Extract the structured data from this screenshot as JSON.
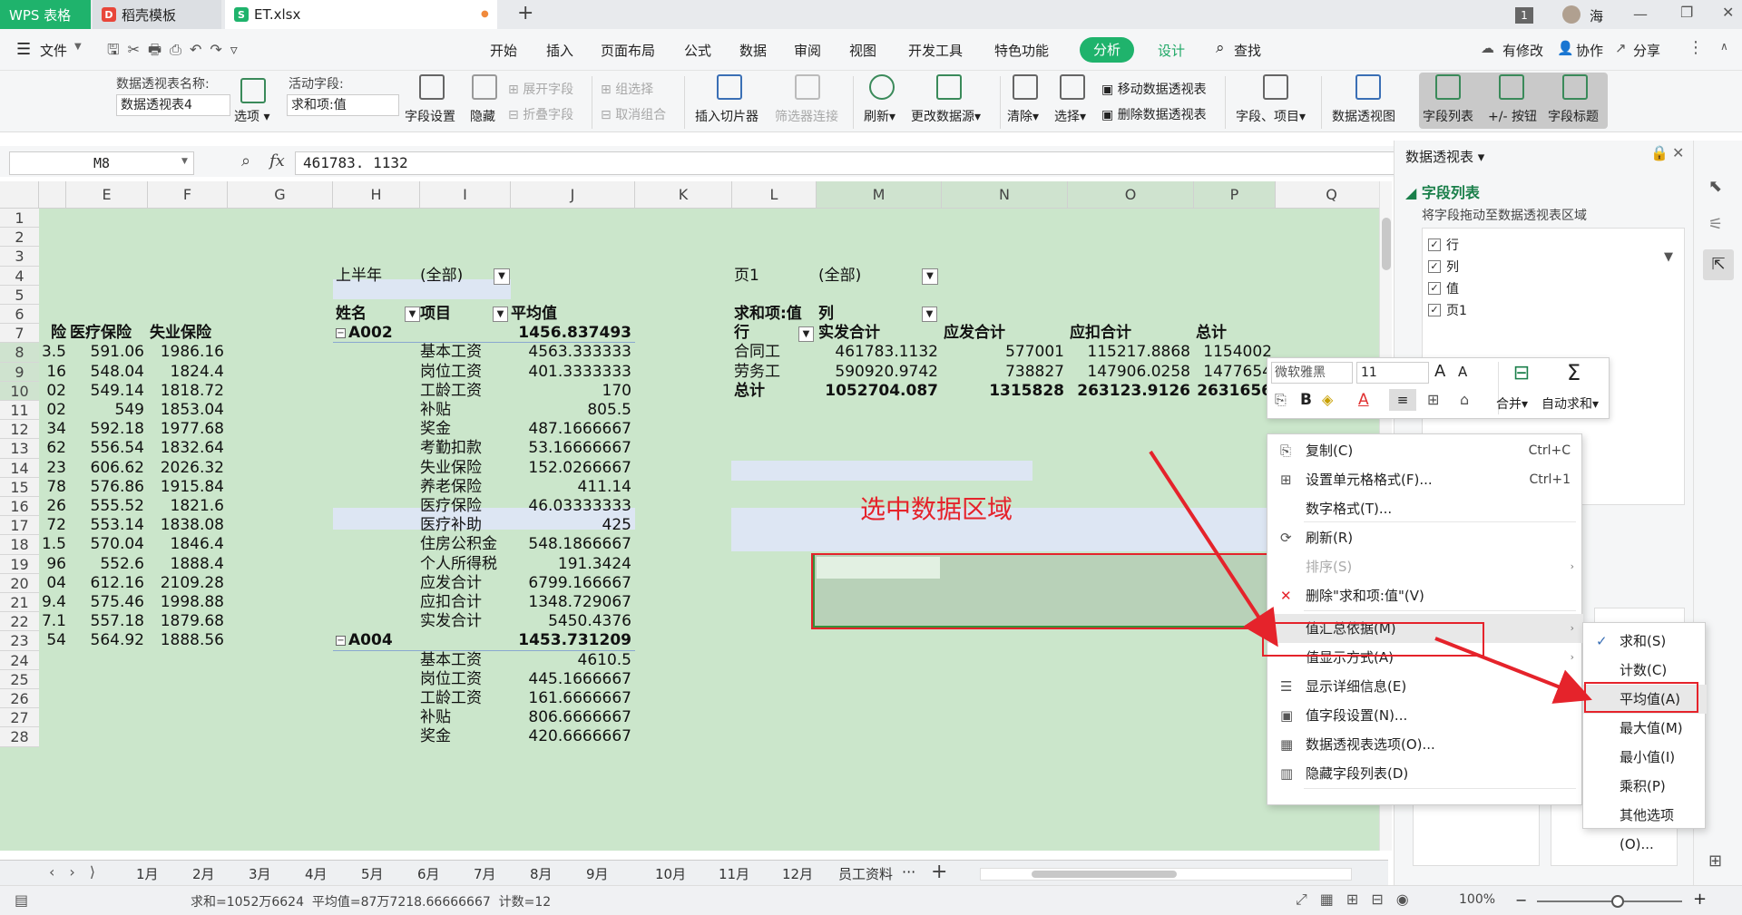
{
  "titlebar": {
    "wps_tab": "WPS 表格",
    "daoke_tab": "稻壳模板",
    "file_tab": "ET.xlsx",
    "new_tab": "+",
    "badge": "1",
    "user": "海"
  },
  "menubar": {
    "file": "文件",
    "items": [
      "开始",
      "插入",
      "页面布局",
      "公式",
      "数据",
      "审阅",
      "视图",
      "开发工具",
      "特色功能"
    ],
    "active": "分析",
    "design": "设计",
    "search": "查找",
    "right": [
      "有修改",
      "协作",
      "分享"
    ]
  },
  "ribbon": {
    "pt_name_label": "数据透视表名称:",
    "pt_name_value": "数据透视表4",
    "options": "选项",
    "active_field_label": "活动字段:",
    "active_field_value": "求和项:值",
    "field_settings": "字段设置",
    "hide": "隐藏",
    "expand_field": "展开字段",
    "collapse_field": "折叠字段",
    "group_sel": "组选择",
    "ungroup": "取消组合",
    "insert_slicer": "插入切片器",
    "filter_conn": "筛选器连接",
    "refresh": "刷新",
    "change_source": "更改数据源",
    "clear": "清除",
    "select": "选择",
    "move_pt": "移动数据透视表",
    "delete_pt": "删除数据透视表",
    "fields_items": "字段、项目",
    "pivot_chart": "数据透视图",
    "field_list": "字段列表",
    "pm_buttons": "+/- 按钮",
    "field_headers": "字段标题"
  },
  "formula": {
    "name_box": "M8",
    "fx": "fx",
    "value": "461783. 1132"
  },
  "columns": [
    "E",
    "F",
    "G",
    "H",
    "I",
    "J",
    "K",
    "L",
    "M",
    "N",
    "O",
    "P",
    "Q"
  ],
  "rows": [
    "1",
    "2",
    "3",
    "4",
    "5",
    "6",
    "7",
    "8",
    "9",
    "10",
    "11",
    "12",
    "13",
    "14",
    "15",
    "16",
    "17",
    "18",
    "19",
    "20",
    "21",
    "22",
    "23",
    "24",
    "25",
    "26",
    "27",
    "28"
  ],
  "left_table": {
    "headers": [
      "医疗保险",
      "失业保险"
    ],
    "d_partial": [
      "3.5",
      "16",
      "02",
      "02",
      "34",
      "62",
      "23",
      "78",
      "26",
      "72",
      "1.5",
      "96",
      "04",
      "9.4",
      "7.1",
      "54"
    ],
    "e_vals": [
      "591.06",
      "548.04",
      "549.14",
      "549",
      "592.18",
      "556.54",
      "606.62",
      "576.86",
      "555.52",
      "553.14",
      "570.04",
      "552.6",
      "612.16",
      "575.46",
      "557.18",
      "564.92"
    ],
    "f_vals": [
      "1986.16",
      "1824.4",
      "1818.72",
      "1853.04",
      "1977.68",
      "1832.64",
      "2026.32",
      "1915.84",
      "1821.6",
      "1838.08",
      "1846.4",
      "1888.4",
      "2109.28",
      "1998.88",
      "1879.68",
      "1888.56"
    ],
    "d_header_partial": "险"
  },
  "pivot1": {
    "filter_label": "上半年",
    "filter_value": "(全部)",
    "headers": [
      "姓名",
      "项目",
      "平均值"
    ],
    "group1": {
      "name": "A002",
      "total": "1456.837493"
    },
    "items1": [
      [
        "基本工资",
        "4563.333333"
      ],
      [
        "岗位工资",
        "401.3333333"
      ],
      [
        "工龄工资",
        "170"
      ],
      [
        "补贴",
        "805.5"
      ],
      [
        "奖金",
        "487.1666667"
      ],
      [
        "考勤扣款",
        "53.16666667"
      ],
      [
        "失业保险",
        "152.0266667"
      ],
      [
        "养老保险",
        "411.14"
      ],
      [
        "医疗保险",
        "46.03333333"
      ],
      [
        "医疗补助",
        "425"
      ],
      [
        "住房公积金",
        "548.1866667"
      ],
      [
        "个人所得税",
        "191.3424"
      ],
      [
        "应发合计",
        "6799.166667"
      ],
      [
        "应扣合计",
        "1348.729067"
      ],
      [
        "实发合计",
        "5450.4376"
      ]
    ],
    "group2": {
      "name": "A004",
      "total": "1453.731209"
    },
    "items2": [
      [
        "基本工资",
        "4610.5"
      ],
      [
        "岗位工资",
        "445.1666667"
      ],
      [
        "工龄工资",
        "161.6666667"
      ],
      [
        "补贴",
        "806.6666667"
      ],
      [
        "奖金",
        "420.6666667"
      ]
    ]
  },
  "pivot2": {
    "filter_label": "页1",
    "filter_value": "(全部)",
    "value_label": "求和项:值",
    "col_label": "列",
    "row_label": "行",
    "col_headers": [
      "实发合计",
      "应发合计",
      "应扣合计",
      "总计"
    ],
    "rows": [
      [
        "合同工",
        "461783.1132",
        "577001",
        "115217.8868",
        "1154002"
      ],
      [
        "劳务工",
        "590920.9742",
        "738827",
        "147906.0258",
        "1477654"
      ],
      [
        "总计",
        "1052704.087",
        "1315828",
        "263123.9126",
        "2631656"
      ]
    ]
  },
  "annotation": "选中数据区域",
  "sheets": [
    "1月",
    "2月",
    "3月",
    "4月",
    "5月",
    "6月",
    "7月",
    "8月",
    "9月",
    "10月",
    "11月",
    "12月",
    "员工资料"
  ],
  "sheet_more": "···",
  "status": {
    "summary": "求和=1052万6624  平均值=87万7218.66666667  计数=12",
    "zoom": "100%"
  },
  "mini_toolbar": {
    "font": "微软雅黑",
    "size": "11",
    "merge": "合并",
    "autosum": "自动求和"
  },
  "context_menu": [
    {
      "label": "复制(C)",
      "shortcut": "Ctrl+C"
    },
    {
      "label": "设置单元格格式(F)...",
      "shortcut": "Ctrl+1"
    },
    {
      "label": "数字格式(T)...",
      "shortcut": ""
    },
    {
      "label": "刷新(R)",
      "shortcut": ""
    },
    {
      "label": "排序(S)",
      "shortcut": ""
    },
    {
      "label": "删除\"求和项:值\"(V)",
      "shortcut": ""
    },
    {
      "label": "值汇总依据(M)",
      "shortcut": ""
    },
    {
      "label": "值显示方式(A)",
      "shortcut": ""
    },
    {
      "label": "显示详细信息(E)",
      "shortcut": ""
    },
    {
      "label": "值字段设置(N)...",
      "shortcut": ""
    },
    {
      "label": "数据透视表选项(O)...",
      "shortcut": ""
    },
    {
      "label": "隐藏字段列表(D)",
      "shortcut": ""
    }
  ],
  "submenu": [
    "求和(S)",
    "计数(C)",
    "平均值(A)",
    "最大值(M)",
    "最小值(I)",
    "乘积(P)",
    "其他选项(O)..."
  ],
  "panel": {
    "title": "数据透视表",
    "section": "字段列表",
    "hint": "将字段拖动至数据透视表区域",
    "fields": [
      "行",
      "列",
      "值",
      "页1"
    ]
  },
  "colors": {
    "green": "#1fb36c",
    "grid_bg": "#cbe6cb",
    "pivot_header": "#dde6f3",
    "red": "#e5232b"
  }
}
